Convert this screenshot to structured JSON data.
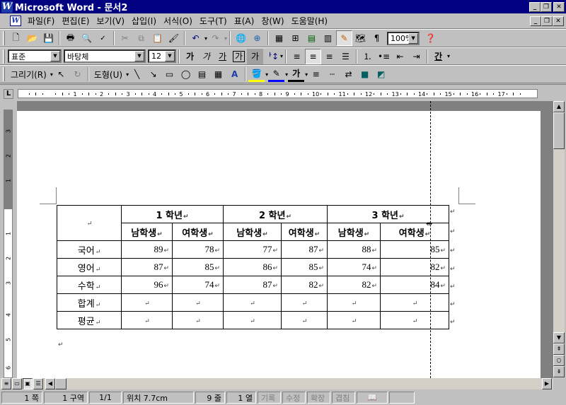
{
  "window": {
    "title": "Microsoft Word - 문서2",
    "app_icon": "W"
  },
  "menubar": {
    "items": [
      "파일(F)",
      "편집(E)",
      "보기(V)",
      "삽입(I)",
      "서식(O)",
      "도구(T)",
      "표(A)",
      "창(W)",
      "도움말(H)"
    ]
  },
  "toolbar_standard": {
    "zoom": "100%"
  },
  "toolbar_format": {
    "style": "표준",
    "font": "바탕체",
    "size": "12",
    "bold": "가",
    "italic": "가",
    "underline": "가",
    "border_char": "가",
    "shade_char": "가",
    "color_char": "간"
  },
  "toolbar_draw": {
    "draw_label": "그리기(R)",
    "autoshape_label": "도형(U)",
    "font_color_char": "가"
  },
  "ruler": {
    "labels": [
      "1",
      "2",
      "3",
      "4",
      "5",
      "6",
      "7",
      "8",
      "9",
      "10",
      "11",
      "12",
      "13",
      "14",
      "15",
      "16",
      "17"
    ]
  },
  "table": {
    "headers_top": [
      "1 학년",
      "2 학년",
      "3 학년"
    ],
    "headers_sub": [
      "남학생",
      "여학생",
      "남학생",
      "여학생",
      "남학생",
      "여학생"
    ],
    "rows": [
      {
        "label": "국어",
        "values": [
          "89",
          "78",
          "77",
          "87",
          "88",
          "85"
        ]
      },
      {
        "label": "영어",
        "values": [
          "87",
          "85",
          "86",
          "85",
          "74",
          "82"
        ]
      },
      {
        "label": "수학",
        "values": [
          "96",
          "74",
          "87",
          "82",
          "82",
          "84"
        ]
      },
      {
        "label": "합계",
        "values": [
          "",
          "",
          "",
          "",
          "",
          ""
        ]
      },
      {
        "label": "평균",
        "values": [
          "",
          "",
          "",
          "",
          "",
          ""
        ]
      }
    ]
  },
  "statusbar": {
    "page": "1 쪽",
    "section": "1 구역",
    "pages": "1/1",
    "position": "위치 7.7cm",
    "line": "9 줄",
    "column": "1 열",
    "rec": "기록",
    "trk": "수정",
    "ext": "확장",
    "ovr": "겹침"
  }
}
